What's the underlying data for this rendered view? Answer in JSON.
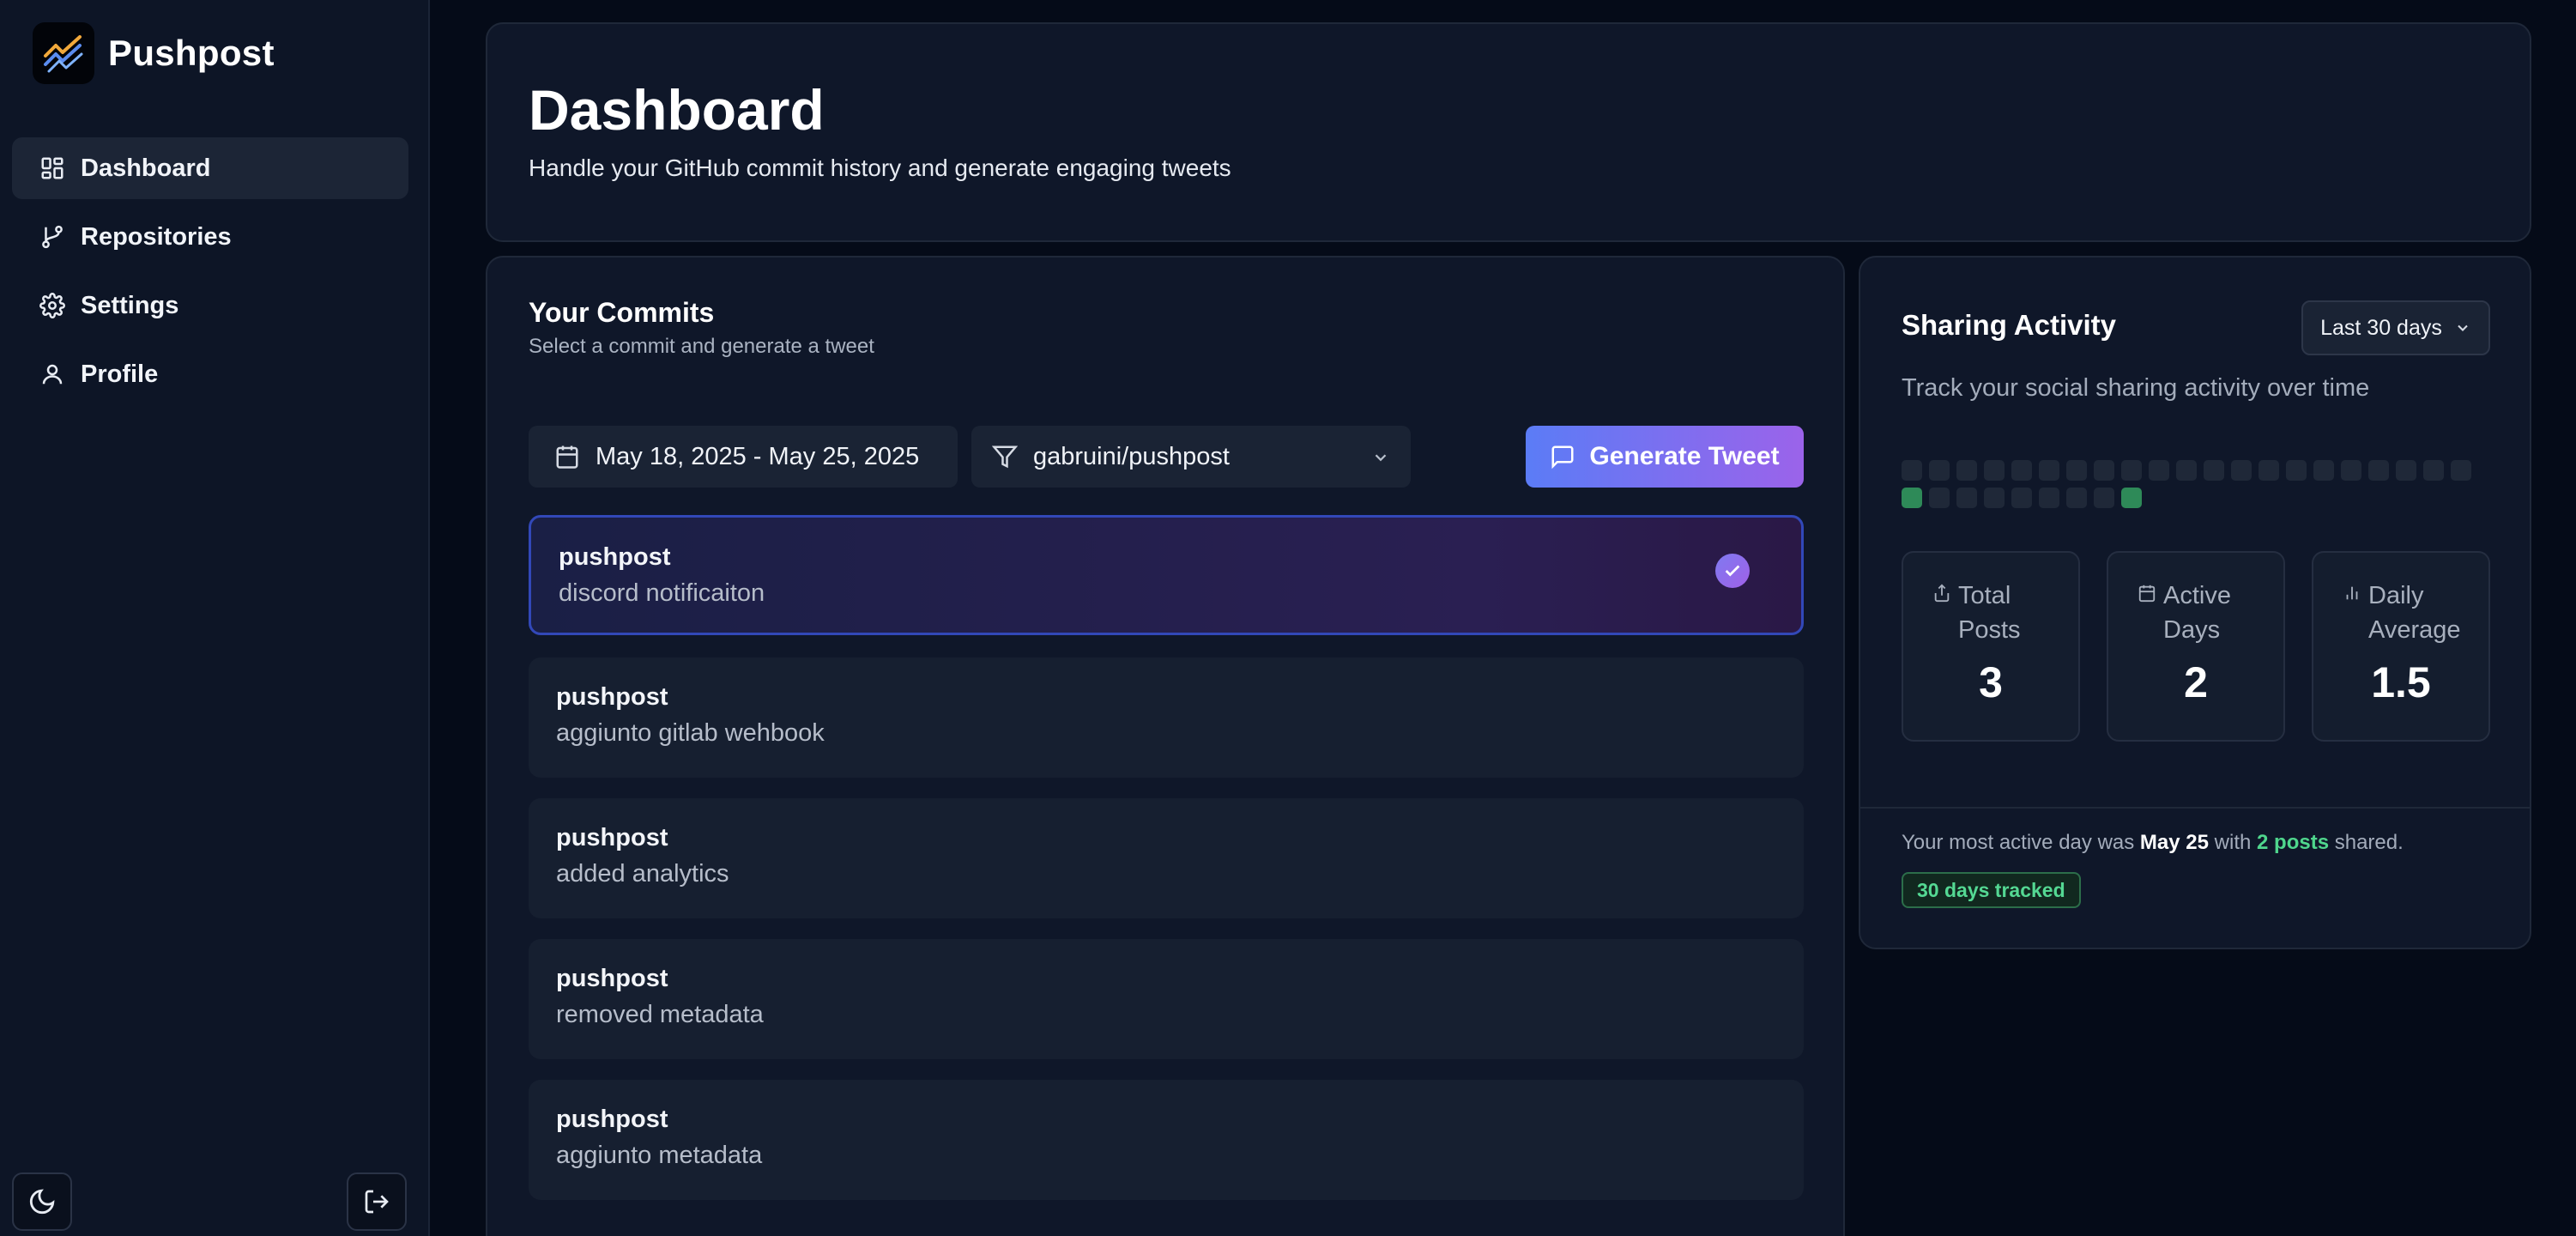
{
  "app": {
    "name": "Pushpost"
  },
  "sidebar": {
    "items": [
      {
        "label": "Dashboard",
        "icon": "dashboard-icon",
        "active": true
      },
      {
        "label": "Repositories",
        "icon": "git-branch-icon",
        "active": false
      },
      {
        "label": "Settings",
        "icon": "gear-icon",
        "active": false
      },
      {
        "label": "Profile",
        "icon": "user-icon",
        "active": false
      }
    ],
    "theme_toggle_icon": "moon-icon",
    "logout_icon": "logout-icon"
  },
  "header": {
    "title": "Dashboard",
    "subtitle": "Handle your GitHub commit history and generate engaging tweets"
  },
  "commits": {
    "title": "Your Commits",
    "subtitle": "Select a commit and generate a tweet",
    "date_range": "May 18, 2025 - May 25, 2025",
    "repo_filter": "gabruini/pushpost",
    "generate_label": "Generate Tweet",
    "items": [
      {
        "repo": "pushpost",
        "message": "discord notificaiton",
        "selected": true
      },
      {
        "repo": "pushpost",
        "message": "aggiunto gitlab wehbook",
        "selected": false
      },
      {
        "repo": "pushpost",
        "message": "added analytics",
        "selected": false
      },
      {
        "repo": "pushpost",
        "message": "removed metadata",
        "selected": false
      },
      {
        "repo": "pushpost",
        "message": "aggiunto metadata",
        "selected": false
      }
    ]
  },
  "activity": {
    "title": "Sharing Activity",
    "range_label": "Last 30 days",
    "subtitle": "Track your social sharing activity over time",
    "heatmap": {
      "days": 30,
      "active_day_indices": [
        21,
        29
      ]
    },
    "stats": [
      {
        "label": "Total Posts",
        "value": "3",
        "icon": "share-icon"
      },
      {
        "label": "Active Days",
        "value": "2",
        "icon": "calendar-icon"
      },
      {
        "label": "Daily Average",
        "value": "1.5",
        "icon": "bar-chart-icon"
      }
    ],
    "note_prefix": "Your most active day was",
    "note_day": "May 25",
    "note_mid": "with",
    "note_posts": "2 posts",
    "note_suffix": "shared.",
    "tracked_badge": "30 days tracked"
  },
  "colors": {
    "accent_gradient_start": "#5b7cf6",
    "accent_gradient_end": "#9b63ea",
    "activity_green": "#2e8a58"
  }
}
